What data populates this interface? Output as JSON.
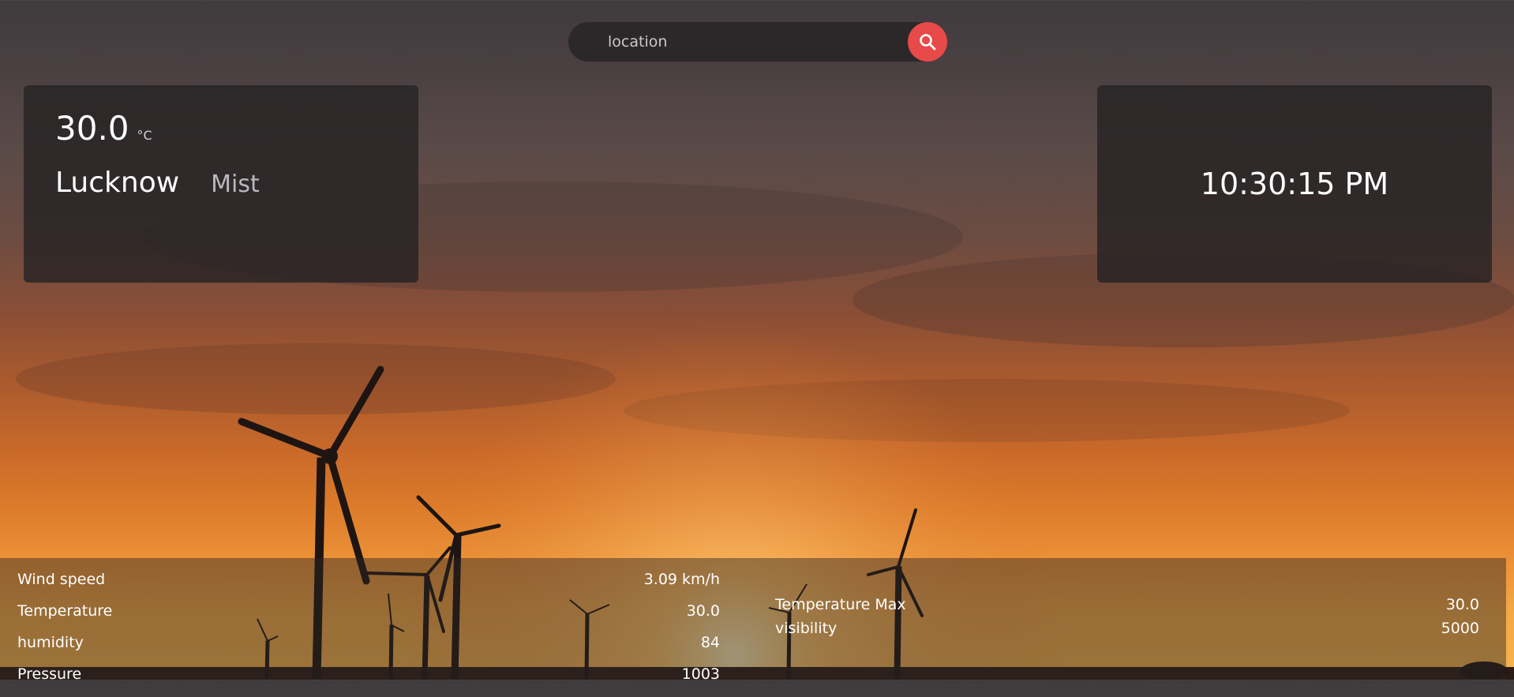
{
  "search": {
    "placeholder": "location",
    "icon": "search-icon",
    "button_color": "#e84a4a"
  },
  "weather": {
    "temperature": "30.0",
    "unit": "°C",
    "city": "Lucknow",
    "condition": "Mist"
  },
  "clock": {
    "time": "10:30:15 PM"
  },
  "stats_left": [
    {
      "label": "Wind speed",
      "value": "3.09 km/h"
    },
    {
      "label": "Temperature",
      "value": "30.0"
    },
    {
      "label": "humidity",
      "value": "84"
    },
    {
      "label": "Pressure",
      "value": "1003"
    }
  ],
  "stats_right": [
    {
      "label": "Temperature Max",
      "value": "30.0"
    },
    {
      "label": "visibility",
      "value": "5000"
    }
  ]
}
